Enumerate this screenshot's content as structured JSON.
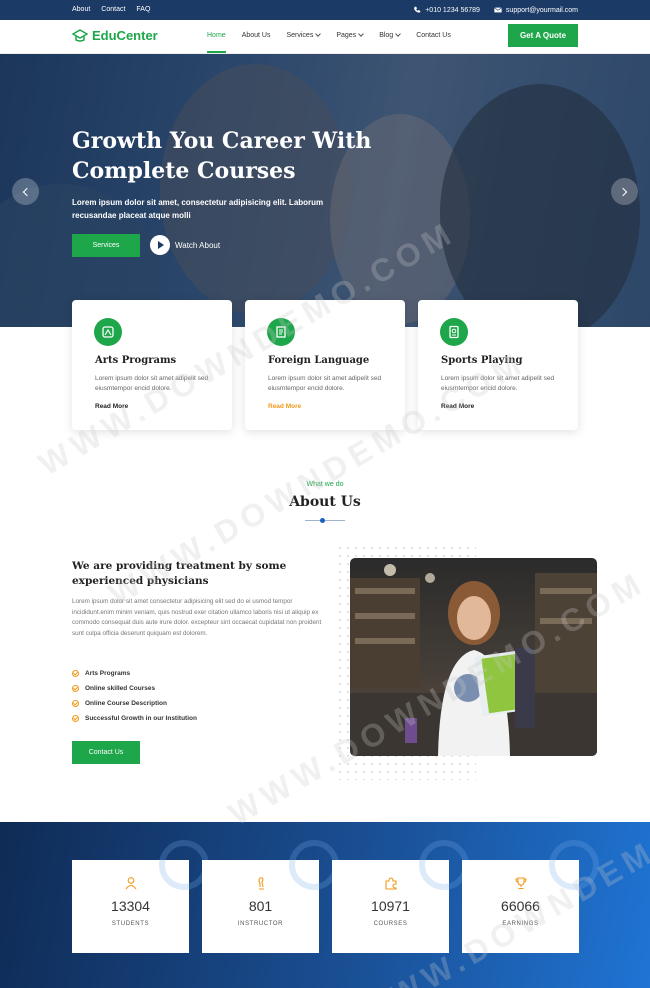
{
  "topbar": {
    "links": [
      "About",
      "Contact",
      "FAQ"
    ],
    "phone": "+010 1234 56789",
    "email": "support@yourmail.com"
  },
  "navbar": {
    "logo": "EduCenter",
    "items": [
      {
        "label": "Home",
        "active": true,
        "dropdown": false
      },
      {
        "label": "About Us",
        "active": false,
        "dropdown": false
      },
      {
        "label": "Services",
        "active": false,
        "dropdown": true
      },
      {
        "label": "Pages",
        "active": false,
        "dropdown": true
      },
      {
        "label": "Blog",
        "active": false,
        "dropdown": true
      },
      {
        "label": "Contact Us",
        "active": false,
        "dropdown": false
      }
    ],
    "cta": "Get A Quote"
  },
  "hero": {
    "title_line1": "Growth You Career With",
    "title_line2": "Complete Courses",
    "subtitle": "Lorem ipsum dolor sit amet, consectetur adipisicing elit. Laborum recusandae placeat atque molli",
    "button": "Services",
    "watch": "Watch About"
  },
  "features": [
    {
      "title": "Arts Programs",
      "desc": "Lorem ipsum dolor sit amet adipelit sed eiusmtempor encid dolore.",
      "link": "Read More",
      "icon": "paint-icon"
    },
    {
      "title": "Foreign Language",
      "desc": "Lorem ipsum dolor sit amet adipelit sed eiusmtempor encid dolore.",
      "link": "Read More",
      "icon": "book-icon"
    },
    {
      "title": "Sports Playing",
      "desc": "Lorem ipsum dolor sit amet adipelit sed eiusmtempor encid dolore.",
      "link": "Read More",
      "icon": "trophy-icon"
    }
  ],
  "about": {
    "tag": "What we do",
    "title": "About Us",
    "heading": "We are providing treatment by some experienced physicians",
    "text": "Lorem ipsum dolor sit amet consectetur adipisicing elit sed do ei usmod tempor incididunt.enim minim veniam, quis nostrud exer citation ullamco laboris nisi ut aliquip ex commodo consequat duis aute irure dolor. excepteur sint occaecat cupidatat non proident sunt culpa officia deserunt quiquam est dolorem.",
    "list": [
      "Arts Programs",
      "Online skilled Courses",
      "Online Course Description",
      "Successful Growth in our Institution"
    ],
    "button": "Contact Us"
  },
  "stats": [
    {
      "value": "13304",
      "label": "STUDENTS",
      "icon": "user-icon"
    },
    {
      "value": "801",
      "label": "INSTRUCTOR",
      "icon": "chess-icon"
    },
    {
      "value": "10971",
      "label": "COURSES",
      "icon": "puzzle-icon"
    },
    {
      "value": "66066",
      "label": "EARNINGS",
      "icon": "trophy-icon"
    }
  ],
  "watermark": "WWW.DOWNDEMO.COM",
  "colors": {
    "green": "#1ea64a",
    "navy": "#1b3a66",
    "orange": "#f19a1a",
    "blue": "#1f74d4"
  }
}
